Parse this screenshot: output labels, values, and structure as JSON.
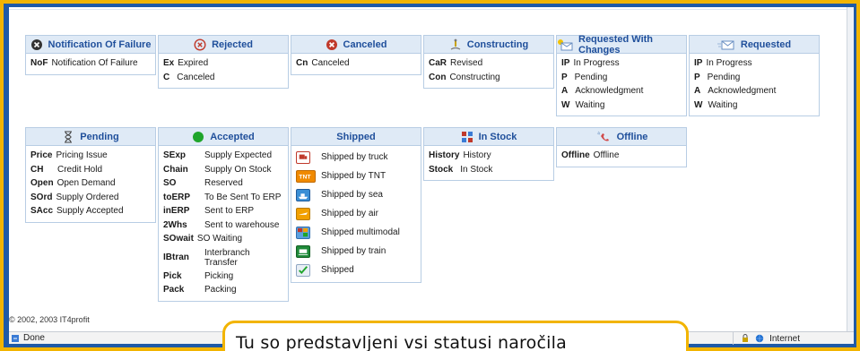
{
  "cards": {
    "nof": {
      "title": "Notification Of Failure",
      "rows": [
        {
          "code": "NoF",
          "text": "Notification Of Failure"
        }
      ]
    },
    "rejected": {
      "title": "Rejected",
      "rows": [
        {
          "code": "Ex",
          "text": "Expired"
        },
        {
          "code": "C",
          "text": "Canceled"
        }
      ]
    },
    "canceled": {
      "title": "Canceled",
      "rows": [
        {
          "code": "Cn",
          "text": "Canceled"
        }
      ]
    },
    "constructing": {
      "title": "Constructing",
      "rows": [
        {
          "code": "CaR",
          "text": "Revised"
        },
        {
          "code": "Con",
          "text": "Constructing"
        }
      ]
    },
    "req_changes": {
      "title": "Requested With Changes",
      "rows": [
        {
          "code": "IP",
          "text": "In Progress"
        },
        {
          "code": "P",
          "text": "Pending"
        },
        {
          "code": "A",
          "text": "Acknowledgment"
        },
        {
          "code": "W",
          "text": "Waiting"
        }
      ]
    },
    "requested": {
      "title": "Requested",
      "rows": [
        {
          "code": "IP",
          "text": "In Progress"
        },
        {
          "code": "P",
          "text": "Pending"
        },
        {
          "code": "A",
          "text": "Acknowledgment"
        },
        {
          "code": "W",
          "text": "Waiting"
        }
      ]
    },
    "pending": {
      "title": "Pending",
      "rows": [
        {
          "code": "Price",
          "text": "Pricing Issue"
        },
        {
          "code": "CH",
          "text": "Credit Hold"
        },
        {
          "code": "Open",
          "text": "Open Demand"
        },
        {
          "code": "SOrd",
          "text": "Supply Ordered"
        },
        {
          "code": "SAcc",
          "text": "Supply Accepted"
        }
      ]
    },
    "accepted": {
      "title": "Accepted",
      "rows": [
        {
          "code": "SExp",
          "text": "Supply Expected"
        },
        {
          "code": "Chain",
          "text": "Supply On Stock"
        },
        {
          "code": "SO",
          "text": "Reserved"
        },
        {
          "code": "toERP",
          "text": "To Be Sent To ERP"
        },
        {
          "code": "inERP",
          "text": "Sent to ERP"
        },
        {
          "code": "2Whs",
          "text": "Sent to warehouse"
        },
        {
          "code": "SOwait",
          "text": "SO Waiting"
        },
        {
          "code": "IBtran",
          "text": "Interbranch Transfer"
        },
        {
          "code": "Pick",
          "text": "Picking"
        },
        {
          "code": "Pack",
          "text": "Packing"
        }
      ]
    },
    "shipped": {
      "title": "Shipped",
      "rows": [
        {
          "text": "Shipped by truck",
          "icon": "truck-icon"
        },
        {
          "text": "Shipped by TNT",
          "icon": "tnt-icon"
        },
        {
          "text": "Shipped by sea",
          "icon": "ship-icon"
        },
        {
          "text": "Shipped by air",
          "icon": "plane-icon"
        },
        {
          "text": "Shipped multimodal",
          "icon": "multimodal-icon"
        },
        {
          "text": "Shipped by train",
          "icon": "train-icon"
        },
        {
          "text": "Shipped",
          "icon": "checkmark-icon"
        }
      ]
    },
    "instock": {
      "title": "In Stock",
      "rows": [
        {
          "code": "History",
          "text": "History"
        },
        {
          "code": "Stock",
          "text": "In Stock"
        }
      ]
    },
    "offline": {
      "title": "Offline",
      "rows": [
        {
          "code": "Offline",
          "text": "Offline"
        }
      ]
    }
  },
  "footer": {
    "copyright": "© 2002, 2003 IT4profit"
  },
  "status_bar": {
    "left": "Done",
    "zone": "Internet"
  },
  "caption": "Tu so predstavljeni vsi statusi naročila",
  "colors": {
    "frame": "#f2b400",
    "header_bg": "#dfeaf6",
    "header_text": "#1f4f9b",
    "backdrop": "#1f5aa6"
  }
}
